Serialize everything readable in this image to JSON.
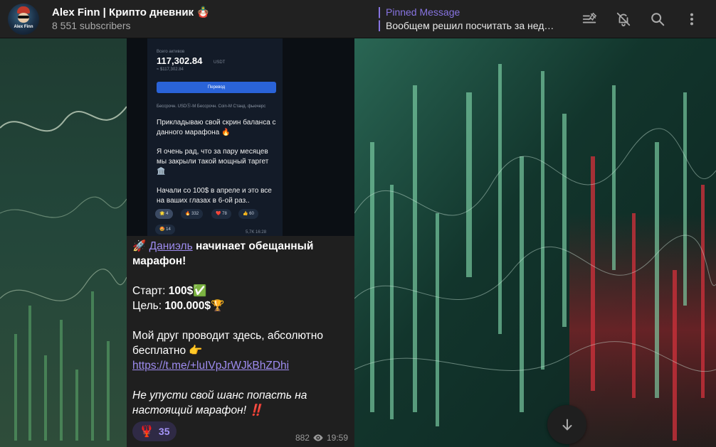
{
  "header": {
    "channel_title": "Alex Finn | Крипто дневник 🪆",
    "subscribers": "8 551 subscribers",
    "avatar_text": "Alex Finn",
    "pinned": {
      "label": "Pinned Message",
      "text": "Вообщем решил посчитать за неделю"
    },
    "icons": [
      "pinned-list-icon",
      "mute-bell-icon",
      "search-icon",
      "more-vertical-icon"
    ]
  },
  "message": {
    "photo": {
      "balance_label": "Всего активов",
      "balance": "117,302.84",
      "currency": "USDT",
      "sub_amount": "≈ $117,302.84",
      "transfer_button": "Перевод",
      "tabs": "Бессрочн. USDⓈ-M     Бессрочн. Coin-M     Станд. фьючерс",
      "text1": "Прикладываю свой скрин баланса с данного марафона 🔥",
      "text2": "Я очень рад, что за пару месяцев мы закрыли такой мощный таргет 🏛️",
      "text3": "Начали со 100$ в апреле и это все на ваших глазах в 6-ой раз..",
      "reactions": [
        {
          "emoji": "🌟",
          "count": "4"
        },
        {
          "emoji": "🔥",
          "count": "332"
        },
        {
          "emoji": "❤️",
          "count": "78"
        },
        {
          "emoji": "👍",
          "count": "60"
        },
        {
          "emoji": "🤩",
          "count": "14"
        }
      ],
      "views_time": "5,7K 16:28"
    },
    "line1_emoji": "🚀",
    "line1_link": "Даниэль",
    "line1_rest": "начинает обещанный марафон!",
    "start": "Старт:",
    "start_value": "100$✅",
    "goal": "Цель:",
    "goal_value": "100.000$🏆",
    "friend_text": "Мой друг проводит здесь, абсолютно бесплатно 👉",
    "url": "https://t.me/+luIVpJrWJkBhZDhi",
    "italic_text": "Не упусти свой шанс попасть на настоящий марафон! ‼️",
    "reaction": {
      "emoji": "🦞",
      "count": "35"
    },
    "views": "882",
    "time": "19:59"
  },
  "colors": {
    "accent": "#8774e1",
    "header_bg": "#212121",
    "bubble_bg": "#1f1f1f",
    "link": "#9e8cf0"
  },
  "scroll_button_icon": "arrow-down-icon"
}
